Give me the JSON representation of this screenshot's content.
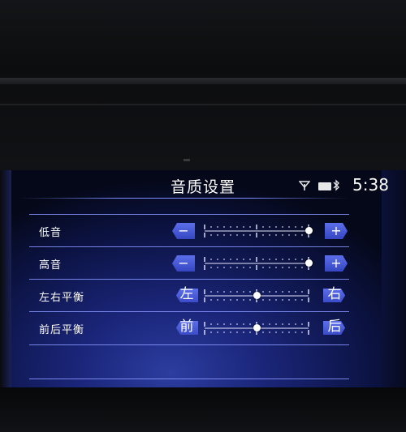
{
  "header": {
    "title": "音质设置",
    "time": "5:38"
  },
  "status_icons": [
    "signal-icon",
    "battery-icon",
    "bluetooth-icon"
  ],
  "rows": [
    {
      "label": "低音",
      "left": "−",
      "right": "+",
      "level": 1.0
    },
    {
      "label": "高音",
      "left": "−",
      "right": "+",
      "level": 1.0
    },
    {
      "label": "左右平衡",
      "left": "左",
      "right": "右",
      "level": 0.5
    },
    {
      "label": "前后平衡",
      "left": "前",
      "right": "后",
      "level": 0.5
    }
  ],
  "colors": {
    "accent": "#4a5ad8",
    "line": "#8a96ff"
  }
}
